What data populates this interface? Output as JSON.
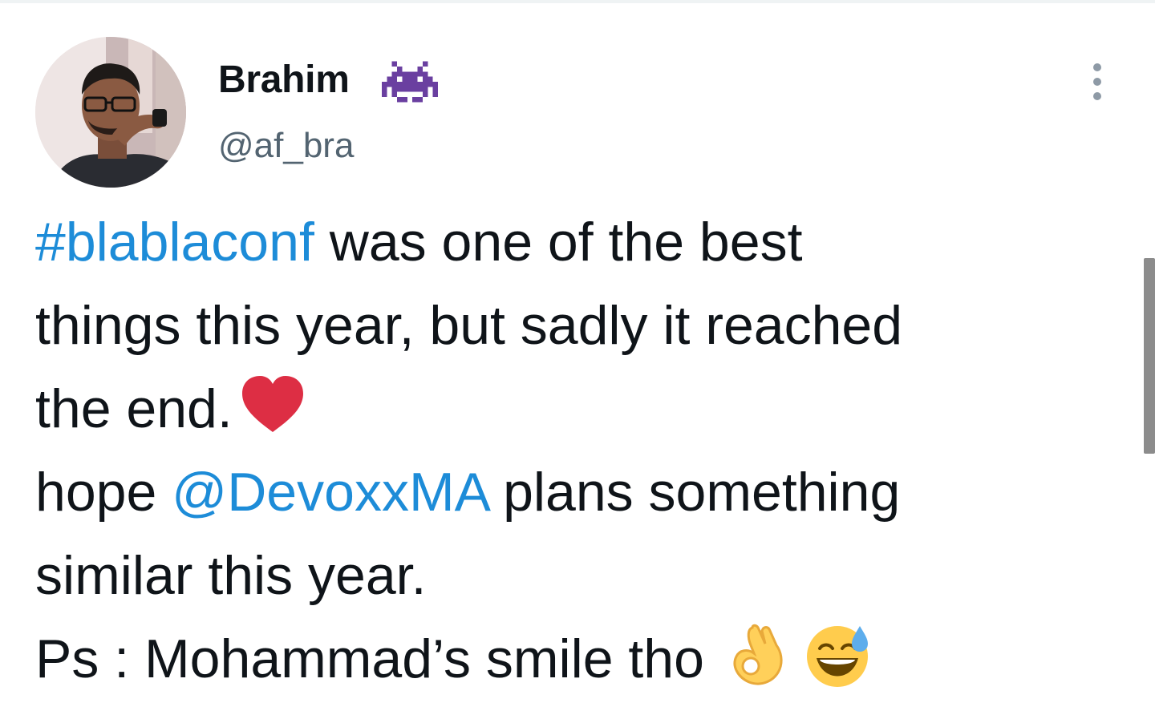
{
  "user": {
    "display_name": "Brahim",
    "handle": "@af_bra",
    "badge_icon": "space-invader-icon",
    "avatar_icon": "profile-photo"
  },
  "menu": {
    "icon": "more-vertical-icon"
  },
  "tweet": {
    "line1": {
      "hashtag": "#blablaconf",
      "text": " was one of the best"
    },
    "line2": {
      "text": "things this year, but sadly it reached"
    },
    "line3": {
      "text": "the end.",
      "emoji": "red-heart-icon"
    },
    "line4": {
      "prefix": "hope ",
      "mention": "@DevoxxMA",
      "suffix": " plans something"
    },
    "line5": {
      "text": "similar this year."
    },
    "line6": {
      "text": "Ps : Mohammad’s smile tho",
      "emoji1": "ok-hand-icon",
      "emoji2": "grinning-sweat-face-icon"
    }
  },
  "colors": {
    "link": "#1d8cd8",
    "text": "#0f1419",
    "secondary": "#536471",
    "heart": "#dd2e44",
    "badge": "#6a3fa0"
  }
}
